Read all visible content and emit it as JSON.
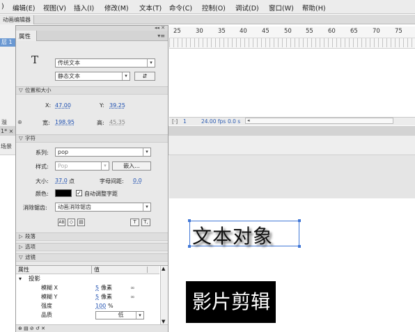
{
  "menubar": {
    "items": [
      "编辑(E)",
      "视图(V)",
      "插入(I)",
      "修改(M)",
      "文本(T)",
      "命令(C)",
      "控制(O)",
      "调试(D)",
      "窗口(W)",
      "帮助(H)"
    ],
    "partial_first": ")"
  },
  "timeline": {
    "tab": "动画编辑器",
    "layer_label": "层 1",
    "ruler_numbers": [
      "25",
      "30",
      "35",
      "40",
      "45",
      "50",
      "55",
      "60",
      "65",
      "70",
      "75"
    ],
    "frame": "1",
    "fps": "24.00 fps",
    "time": "0.0 s"
  },
  "left_fragments": {
    "a": "溢",
    "b": "1* ×",
    "c": "场景"
  },
  "panel": {
    "top_controls": "◂◂ ✕",
    "tab": "属性",
    "menu_glyph": "▾≡",
    "icon_glyph": "T",
    "text_engine": "传统文本",
    "text_type": "静态文本",
    "orient_btn": "⇵",
    "pos_size": {
      "header": "位置和大小",
      "x_label": "X:",
      "x_value": "47.00",
      "y_label": "Y:",
      "y_value": "39.25",
      "w_label": "宽:",
      "w_value": "198.95",
      "h_label": "高:",
      "h_value": "45.35",
      "link_glyph": "⊕"
    },
    "char": {
      "header": "字符",
      "family_label": "系列:",
      "family_value": "pop",
      "style_label": "样式:",
      "style_value": "Pop",
      "embed_btn": "嵌入...",
      "size_label": "大小:",
      "size_value": "37.0",
      "size_unit": "点",
      "spacing_label": "字母间距:",
      "spacing_value": "0.0",
      "color_label": "颜色:",
      "color": "#000000",
      "autokern_label": "自动调整字距",
      "autokern_checked": "✓",
      "aa_label": "消除锯齿:",
      "aa_value": "动画消除锯齿",
      "icon1": "AB",
      "icon2": "◇",
      "icon3": "▤",
      "sup_icon": "T",
      "sub_icon": "T,"
    },
    "sections": {
      "paragraph": "段落",
      "options": "选项",
      "filters": "滤镜"
    },
    "filters": {
      "col_prop": "属性",
      "col_value": "值",
      "group": "投影",
      "rows": [
        {
          "label": "模糊 X",
          "value": "5",
          "unit": "像素",
          "link": "∞"
        },
        {
          "label": "模糊 Y",
          "value": "5",
          "unit": "像素",
          "link": "∞"
        },
        {
          "label": "强度",
          "value": "100",
          "unit": "%",
          "link": ""
        },
        {
          "label": "品质",
          "value": "低",
          "unit": "",
          "link": ""
        }
      ],
      "bottom_icons": "⊕ ▤ ⊘ ↺ ✕"
    }
  },
  "stage": {
    "text_object": "文本对象",
    "movie_clip": "影片剪辑"
  },
  "colors": {
    "link_blue": "#1e4fb0",
    "selection_blue": "#3f76d6",
    "layer_blue": "#6a98d2"
  }
}
